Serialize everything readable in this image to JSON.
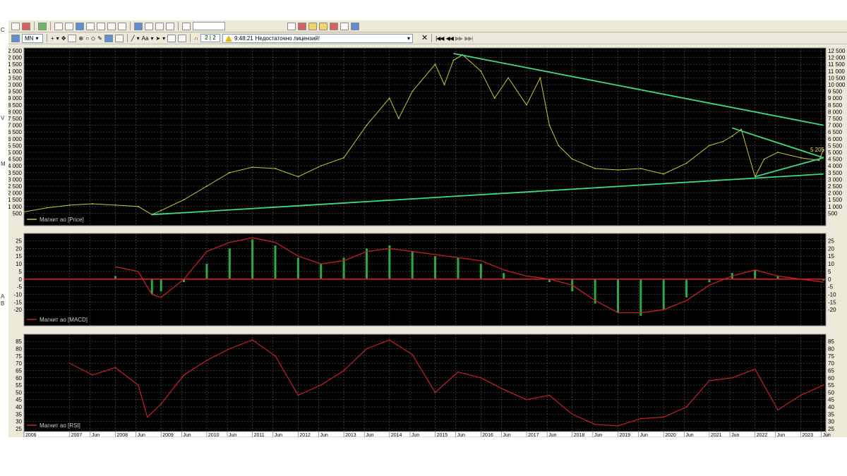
{
  "toolbar": {
    "instrument": "MN",
    "counter": "2 | 2",
    "time": "9:48:21",
    "message": "Недостаточно лицензий!"
  },
  "left_strip": [
    "C",
    "V",
    "M",
    "A",
    "B"
  ],
  "chart_data": [
    {
      "type": "line",
      "legend": "Магнит ао [Price]",
      "ylim": [
        0,
        12500
      ],
      "y_ticks": [
        500,
        1000,
        1500,
        2000,
        2500,
        3000,
        3500,
        4000,
        4500,
        5000,
        5500,
        6000,
        6500,
        7000,
        7500,
        8000,
        8500,
        9000,
        9500,
        10000,
        10500,
        11000,
        11500,
        12000,
        12500
      ],
      "y_tick_labels": [
        "500",
        "1 000",
        "1 500",
        "2 000",
        "2 500",
        "3 000",
        "3 500",
        "4 000",
        "4 500",
        "5 000",
        "5 500",
        "6 000",
        "6 500",
        "7 000",
        "7 500",
        "8 000",
        "8 500",
        "9 000",
        "9 500",
        "10 000",
        "10 500",
        "11 000",
        "11 500",
        "12 000",
        "12 500"
      ],
      "last_value_label": "5 205",
      "colors": {
        "price": "#c8c83c",
        "trendline": "#3ddc84"
      },
      "x": [
        2006.0,
        2006.5,
        2007.0,
        2007.5,
        2008.0,
        2008.5,
        2008.8,
        2009.0,
        2009.5,
        2010.0,
        2010.5,
        2011.0,
        2011.5,
        2012.0,
        2012.5,
        2013.0,
        2013.5,
        2014.0,
        2014.2,
        2014.5,
        2015.0,
        2015.2,
        2015.4,
        2015.6,
        2016.0,
        2016.3,
        2016.6,
        2017.0,
        2017.3,
        2017.5,
        2017.7,
        2018.0,
        2018.5,
        2019.0,
        2019.5,
        2020.0,
        2020.5,
        2021.0,
        2021.3,
        2021.5,
        2021.7,
        2022.0,
        2022.2,
        2022.5,
        2023.0,
        2023.4,
        2023.5
      ],
      "values": [
        600,
        900,
        1100,
        1200,
        1100,
        1000,
        400,
        700,
        1500,
        2500,
        3500,
        3900,
        3800,
        3200,
        4000,
        4600,
        7000,
        9000,
        7500,
        9500,
        11500,
        10000,
        11800,
        12200,
        11000,
        9000,
        10500,
        8500,
        10500,
        7000,
        5500,
        4500,
        3800,
        3700,
        3800,
        3400,
        4200,
        5500,
        5800,
        6200,
        6700,
        3200,
        4500,
        5000,
        4600,
        4400,
        5205
      ],
      "trendlines": [
        {
          "from": [
            2015.4,
            12300
          ],
          "to": [
            2023.5,
            7000
          ]
        },
        {
          "from": [
            2008.8,
            400
          ],
          "to": [
            2023.5,
            3400
          ]
        },
        {
          "from": [
            2021.5,
            6800
          ],
          "to": [
            2023.5,
            4600
          ]
        },
        {
          "from": [
            2022.0,
            3200
          ],
          "to": [
            2023.5,
            4600
          ]
        }
      ]
    },
    {
      "type": "bar",
      "legend": "Магнит ао [MACD]",
      "ylim": [
        -25,
        28
      ],
      "y_ticks": [
        -20,
        -15,
        -10,
        -5,
        0,
        5,
        10,
        15,
        20,
        25
      ],
      "y_tick_labels": [
        "-20",
        "-15",
        "-10",
        "-5",
        "0",
        "5",
        "10",
        "15",
        "20",
        "25"
      ],
      "colors": {
        "histogram": "#2fa84a",
        "signal": "#c82020"
      },
      "x": [
        2008.0,
        2008.5,
        2008.8,
        2009.0,
        2009.5,
        2010.0,
        2010.5,
        2011.0,
        2011.5,
        2012.0,
        2012.5,
        2013.0,
        2013.5,
        2014.0,
        2014.5,
        2015.0,
        2015.5,
        2016.0,
        2016.5,
        2017.0,
        2017.5,
        2018.0,
        2018.5,
        2019.0,
        2019.5,
        2020.0,
        2020.5,
        2021.0,
        2021.5,
        2022.0,
        2022.5,
        2023.0,
        2023.5
      ],
      "histogram": [
        2,
        0,
        -10,
        -8,
        -2,
        10,
        20,
        26,
        22,
        14,
        10,
        14,
        20,
        22,
        18,
        15,
        14,
        10,
        4,
        0,
        -2,
        -8,
        -16,
        -22,
        -24,
        -20,
        -12,
        -2,
        4,
        6,
        2,
        0,
        -1
      ],
      "signal": [
        8,
        5,
        -10,
        -12,
        0,
        18,
        24,
        27,
        24,
        15,
        10,
        12,
        18,
        20,
        18,
        16,
        14,
        12,
        6,
        2,
        0,
        -4,
        -14,
        -22,
        -22,
        -20,
        -14,
        -4,
        2,
        6,
        2,
        0,
        -2
      ]
    },
    {
      "type": "line",
      "legend": "Магнит ао [RSI]",
      "ylim": [
        25,
        88
      ],
      "y_ticks": [
        25,
        30,
        35,
        40,
        45,
        50,
        55,
        60,
        65,
        70,
        75,
        80,
        85
      ],
      "y_tick_labels": [
        "25",
        "30",
        "35",
        "40",
        "45",
        "50",
        "55",
        "60",
        "65",
        "70",
        "75",
        "80",
        "85"
      ],
      "colors": {
        "rsi": "#c82020"
      },
      "x": [
        2007.0,
        2007.5,
        2008.0,
        2008.5,
        2008.7,
        2009.0,
        2009.5,
        2010.0,
        2010.5,
        2011.0,
        2011.5,
        2012.0,
        2012.5,
        2013.0,
        2013.5,
        2014.0,
        2014.5,
        2015.0,
        2015.5,
        2016.0,
        2016.5,
        2017.0,
        2017.5,
        2018.0,
        2018.5,
        2019.0,
        2019.5,
        2020.0,
        2020.5,
        2021.0,
        2021.5,
        2022.0,
        2022.5,
        2023.0,
        2023.5
      ],
      "values": [
        70,
        62,
        67,
        55,
        33,
        42,
        62,
        72,
        80,
        86,
        75,
        48,
        55,
        65,
        80,
        86,
        76,
        50,
        64,
        60,
        52,
        45,
        48,
        35,
        28,
        27,
        32,
        33,
        40,
        58,
        60,
        66,
        38,
        48,
        55
      ]
    }
  ],
  "x_axis": {
    "labels": [
      "2006",
      "2007",
      "Jun",
      "2008",
      "Jun",
      "2009",
      "Jun",
      "2010",
      "Jun",
      "2011",
      "Jun",
      "2012",
      "Jun",
      "2013",
      "Jun",
      "2014",
      "Jun",
      "2015",
      "Jun",
      "2016",
      "Jun",
      "2017",
      "Jun",
      "2018",
      "Jun",
      "2019",
      "Jun",
      "2020",
      "Jun",
      "2021",
      "Jun",
      "2022",
      "Jun",
      "2023",
      "Jun"
    ],
    "positions": [
      2006.0,
      2007.0,
      2007.45,
      2008.0,
      2008.45,
      2009.0,
      2009.45,
      2010.0,
      2010.45,
      2011.0,
      2011.45,
      2012.0,
      2012.45,
      2013.0,
      2013.45,
      2014.0,
      2014.45,
      2015.0,
      2015.45,
      2016.0,
      2016.45,
      2017.0,
      2017.45,
      2018.0,
      2018.45,
      2019.0,
      2019.45,
      2020.0,
      2020.45,
      2021.0,
      2021.45,
      2022.0,
      2022.45,
      2023.0,
      2023.45
    ]
  }
}
